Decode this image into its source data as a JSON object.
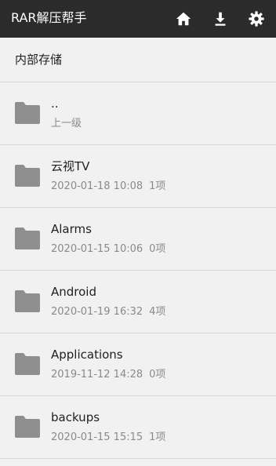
{
  "app_bar": {
    "title": "RAR解压帮手",
    "icons": [
      "home-icon",
      "download-icon",
      "gear-icon"
    ]
  },
  "path_bar": {
    "path": "内部存储"
  },
  "colors": {
    "app_bar_bg": "#2b2b2b",
    "background": "#f1f1f1",
    "folder_icon": "#8f8f8f"
  },
  "files": [
    {
      "name": "..",
      "date": "",
      "count": "上一级"
    },
    {
      "name": "云视TV",
      "date": "2020-01-18 10:08",
      "count": "1项"
    },
    {
      "name": "Alarms",
      "date": "2020-01-15 10:06",
      "count": "0项"
    },
    {
      "name": "Android",
      "date": "2020-01-19 16:32",
      "count": "4项"
    },
    {
      "name": "Applications",
      "date": "2019-11-12 14:28",
      "count": "0项"
    },
    {
      "name": "backups",
      "date": "2020-01-15 15:15",
      "count": "1项"
    }
  ]
}
